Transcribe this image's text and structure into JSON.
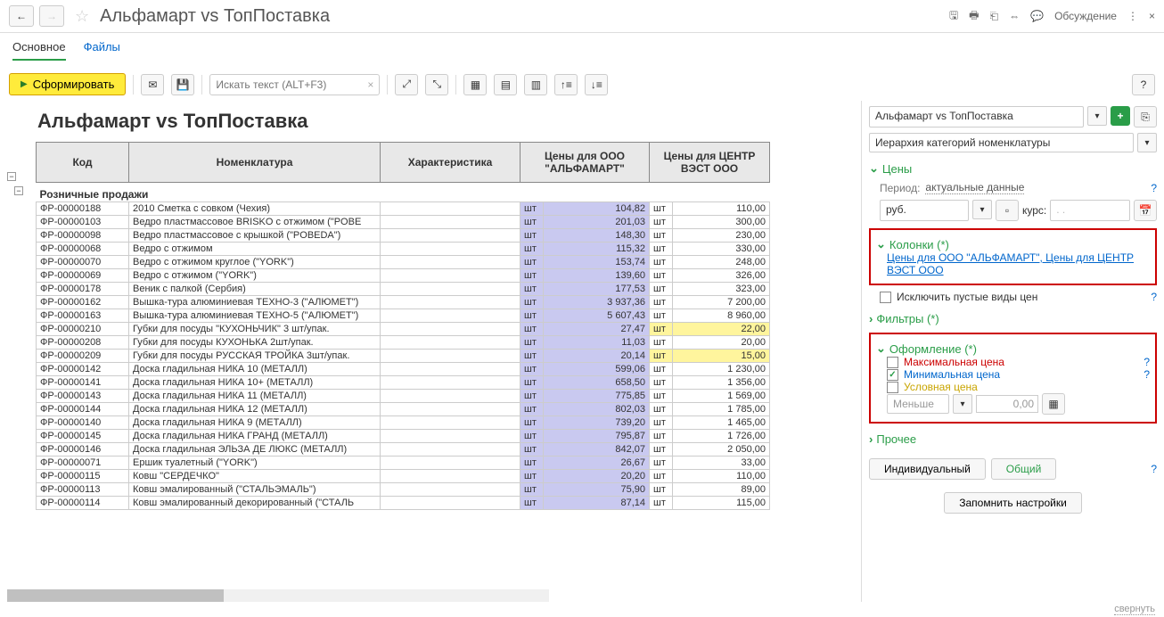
{
  "header": {
    "title": "Альфамарт vs ТопПоставка",
    "discuss": "Обсуждение"
  },
  "tabs": {
    "main": "Основное",
    "files": "Файлы"
  },
  "actions": {
    "form": "Сформировать",
    "search_ph": "Искать текст (ALT+F3)"
  },
  "report": {
    "title": "Альфамарт vs ТопПоставка",
    "cols": {
      "code": "Код",
      "nom": "Номенклатура",
      "char": "Характеристика",
      "p1": "Цены для ООО \"АЛЬФАМАРТ\"",
      "p2": "Цены для ЦЕНТР ВЭСТ ООО"
    },
    "group": "Розничные продажи",
    "unit": "шт",
    "rows": [
      {
        "code": "ФР-00000188",
        "nom": "2010 Сметка с совком (Чехия)",
        "p1": "104,82",
        "p2": "110,00",
        "hl": ""
      },
      {
        "code": "ФР-00000103",
        "nom": "Ведро пластмассовое BRISKO с отжимом (\"POBE",
        "p1": "201,03",
        "p2": "300,00",
        "hl": ""
      },
      {
        "code": "ФР-00000098",
        "nom": "Ведро пластмассовое с крышкой (\"POBEDA\")",
        "p1": "148,30",
        "p2": "230,00",
        "hl": ""
      },
      {
        "code": "ФР-00000068",
        "nom": "Ведро с отжимом",
        "p1": "115,32",
        "p2": "330,00",
        "hl": ""
      },
      {
        "code": "ФР-00000070",
        "nom": "Ведро с отжимом  круглое (\"YORK\")",
        "p1": "153,74",
        "p2": "248,00",
        "hl": ""
      },
      {
        "code": "ФР-00000069",
        "nom": "Ведро с отжимом (\"YORK\")",
        "p1": "139,60",
        "p2": "326,00",
        "hl": ""
      },
      {
        "code": "ФР-00000178",
        "nom": "Веник с палкой (Сербия)",
        "p1": "177,53",
        "p2": "323,00",
        "hl": ""
      },
      {
        "code": "ФР-00000162",
        "nom": "Вышка-тура алюминиевая ТЕХНО-3 (\"АЛЮМЕТ\")",
        "p1": "3 937,36",
        "p2": "7 200,00",
        "hl": ""
      },
      {
        "code": "ФР-00000163",
        "nom": "Вышка-тура алюминиевая ТЕХНО-5 (\"АЛЮМЕТ\")",
        "p1": "5 607,43",
        "p2": "8 960,00",
        "hl": ""
      },
      {
        "code": "ФР-00000210",
        "nom": "Губки для посуды \"КУХОНЬЧИК\" 3 шт/упак.",
        "p1": "27,47",
        "p2": "22,00",
        "hl": "y"
      },
      {
        "code": "ФР-00000208",
        "nom": "Губки для посуды КУХОНЬКА 2шт/упак.",
        "p1": "11,03",
        "p2": "20,00",
        "hl": ""
      },
      {
        "code": "ФР-00000209",
        "nom": "Губки для посуды РУССКАЯ ТРОЙКА 3шт/упак.",
        "p1": "20,14",
        "p2": "15,00",
        "hl": "y"
      },
      {
        "code": "ФР-00000142",
        "nom": "Доска гладильная  НИКА 10 (МЕТАЛЛ)",
        "p1": "599,06",
        "p2": "1 230,00",
        "hl": ""
      },
      {
        "code": "ФР-00000141",
        "nom": "Доска гладильная  НИКА 10+ (МЕТАЛЛ)",
        "p1": "658,50",
        "p2": "1 356,00",
        "hl": ""
      },
      {
        "code": "ФР-00000143",
        "nom": "Доска гладильная  НИКА 11 (МЕТАЛЛ)",
        "p1": "775,85",
        "p2": "1 569,00",
        "hl": ""
      },
      {
        "code": "ФР-00000144",
        "nom": "Доска гладильная  НИКА 12 (МЕТАЛЛ)",
        "p1": "802,03",
        "p2": "1 785,00",
        "hl": ""
      },
      {
        "code": "ФР-00000140",
        "nom": "Доска гладильная  НИКА 9 (МЕТАЛЛ)",
        "p1": "739,20",
        "p2": "1 465,00",
        "hl": ""
      },
      {
        "code": "ФР-00000145",
        "nom": "Доска гладильная  НИКА ГРАНД (МЕТАЛЛ)",
        "p1": "795,87",
        "p2": "1 726,00",
        "hl": ""
      },
      {
        "code": "ФР-00000146",
        "nom": "Доска гладильная  ЭЛЬЗА ДЕ ЛЮКС (МЕТАЛЛ)",
        "p1": "842,07",
        "p2": "2 050,00",
        "hl": ""
      },
      {
        "code": "ФР-00000071",
        "nom": "Ершик туалетный (\"YORK\")",
        "p1": "26,67",
        "p2": "33,00",
        "hl": ""
      },
      {
        "code": "ФР-00000115",
        "nom": "Ковш \"СЕРДЕЧКО\"",
        "p1": "20,20",
        "p2": "110,00",
        "hl": ""
      },
      {
        "code": "ФР-00000113",
        "nom": "Ковш эмалированный (\"СТАЛЬЭМАЛЬ\")",
        "p1": "75,90",
        "p2": "89,00",
        "hl": ""
      },
      {
        "code": "ФР-00000114",
        "nom": "Ковш эмалированный декорированный (\"СТАЛЬ",
        "p1": "87,14",
        "p2": "115,00",
        "hl": ""
      }
    ]
  },
  "settings": {
    "variant": "Альфамарт vs ТопПоставка",
    "hierarchy": "Иерархия категорий номенклатуры",
    "prices_hdr": "Цены",
    "period_lbl": "Период:",
    "period_val": "актуальные данные",
    "currency": "руб.",
    "rate_lbl": "курс:",
    "rate_val": ".  .",
    "cols_hdr": "Колонки (*)",
    "cols_link": "Цены для ООО \"АЛЬФАМАРТ\", Цены для ЦЕНТР ВЭСТ ООО",
    "exclude_empty": "Исключить пустые виды цен",
    "filters_hdr": "Фильтры (*)",
    "design_hdr": "Оформление (*)",
    "max_price": "Максимальная цена",
    "min_price": "Минимальная цена",
    "cond_price": "Условная цена",
    "cond_op": "Меньше",
    "cond_val": "0,00",
    "other_hdr": "Прочее",
    "btn_ind": "Индивидуальный",
    "btn_common": "Общий",
    "btn_remember": "Запомнить настройки"
  },
  "footer": {
    "collapse": "свернуть"
  }
}
